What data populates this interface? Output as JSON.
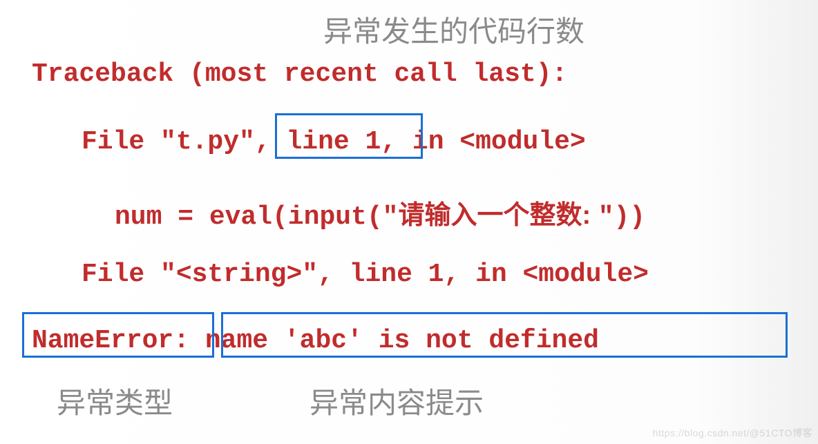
{
  "annotations": {
    "top": "异常发生的代码行数",
    "errtype": "异常类型",
    "errmsg": "异常内容提示"
  },
  "traceback": {
    "header": "Traceback (most recent call last):",
    "frame1_prefix": "File \"t.py\",",
    "frame1_line": " line 1, ",
    "frame1_suffix": "in <module>",
    "code_line_prefix": "num = eval(input(\"",
    "code_line_prompt": "请输入一个整数: ",
    "code_line_suffix": "\"))",
    "frame2": "File \"<string>\", line 1, in <module>",
    "error_type": "NameError:",
    "error_msg": "name 'abc' is not defined"
  },
  "watermark": "https://blog.csdn.net/@51CTO博客"
}
